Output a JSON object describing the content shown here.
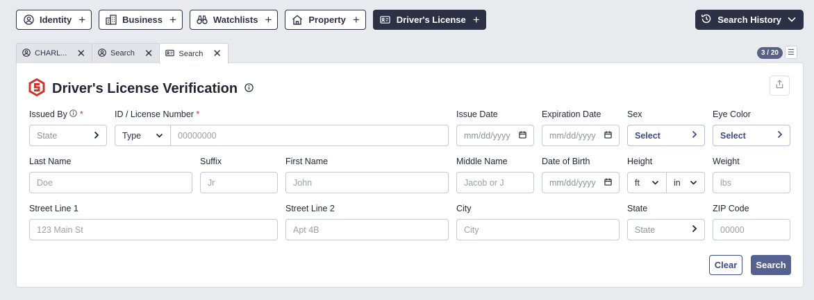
{
  "nav": {
    "items": [
      {
        "label": "Identity",
        "icon": "user-circle-icon"
      },
      {
        "label": "Business",
        "icon": "building-icon"
      },
      {
        "label": "Watchlists",
        "icon": "binoculars-icon"
      },
      {
        "label": "Property",
        "icon": "house-icon"
      },
      {
        "label": "Driver's License",
        "icon": "id-card-icon"
      }
    ],
    "history_label": "Search History"
  },
  "tabs": [
    {
      "label": "CHARL...",
      "icon": "user-circle-icon"
    },
    {
      "label": "Search",
      "icon": "user-circle-icon"
    },
    {
      "label": "Search",
      "icon": "id-card-icon"
    }
  ],
  "tab_counter": "3 / 20",
  "page": {
    "title": "Driver's License Verification",
    "accent": "#d0332c"
  },
  "form": {
    "issued_by": {
      "label": "Issued By",
      "value": "State"
    },
    "license": {
      "label": "ID / License Number",
      "type_value": "Type",
      "placeholder": "00000000"
    },
    "issue_date": {
      "label": "Issue Date",
      "placeholder": "mm/dd/yyyy"
    },
    "expiration_date": {
      "label": "Expiration Date",
      "placeholder": "mm/dd/yyyy"
    },
    "sex": {
      "label": "Sex",
      "value": "Select"
    },
    "eye_color": {
      "label": "Eye Color",
      "value": "Select"
    },
    "last_name": {
      "label": "Last Name",
      "placeholder": "Doe"
    },
    "suffix": {
      "label": "Suffix",
      "placeholder": "Jr"
    },
    "first_name": {
      "label": "First Name",
      "placeholder": "John"
    },
    "middle_name": {
      "label": "Middle Name",
      "placeholder": "Jacob or J"
    },
    "dob": {
      "label": "Date of Birth",
      "placeholder": "mm/dd/yyyy"
    },
    "height": {
      "label": "Height",
      "ft": "ft",
      "in": "in"
    },
    "weight": {
      "label": "Weight",
      "placeholder": "lbs"
    },
    "street1": {
      "label": "Street Line 1",
      "placeholder": "123 Main St"
    },
    "street2": {
      "label": "Street Line 2",
      "placeholder": "Apt 4B"
    },
    "city": {
      "label": "City",
      "placeholder": "City"
    },
    "state": {
      "label": "State",
      "value": "State"
    },
    "zip": {
      "label": "ZIP Code",
      "placeholder": "00000"
    }
  },
  "actions": {
    "clear": "Clear",
    "search": "Search"
  }
}
